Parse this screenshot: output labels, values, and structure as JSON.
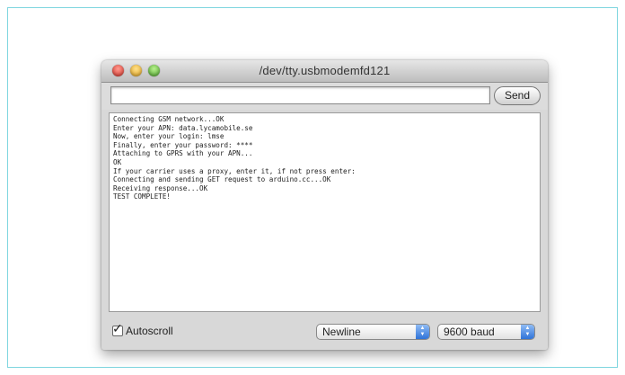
{
  "window": {
    "title": "/dev/tty.usbmodemfd121"
  },
  "toolbar": {
    "input_value": "",
    "send_label": "Send"
  },
  "console": {
    "lines": [
      "Connecting GSM network...OK",
      "Enter your APN: data.lycamobile.se",
      "Now, enter your login: lmse",
      "Finally, enter your password: ****",
      "Attaching to GPRS with your APN...",
      "OK",
      "If your carrier uses a proxy, enter it, if not press enter:",
      "Connecting and sending GET request to arduino.cc...OK",
      "Receiving response...OK",
      "TEST COMPLETE!"
    ]
  },
  "statusbar": {
    "autoscroll_label": "Autoscroll",
    "autoscroll_checked": true,
    "line_ending": "Newline",
    "baud_rate": "9600 baud"
  },
  "icons": {
    "check": "check-icon",
    "updown": "updown-arrows-icon"
  }
}
